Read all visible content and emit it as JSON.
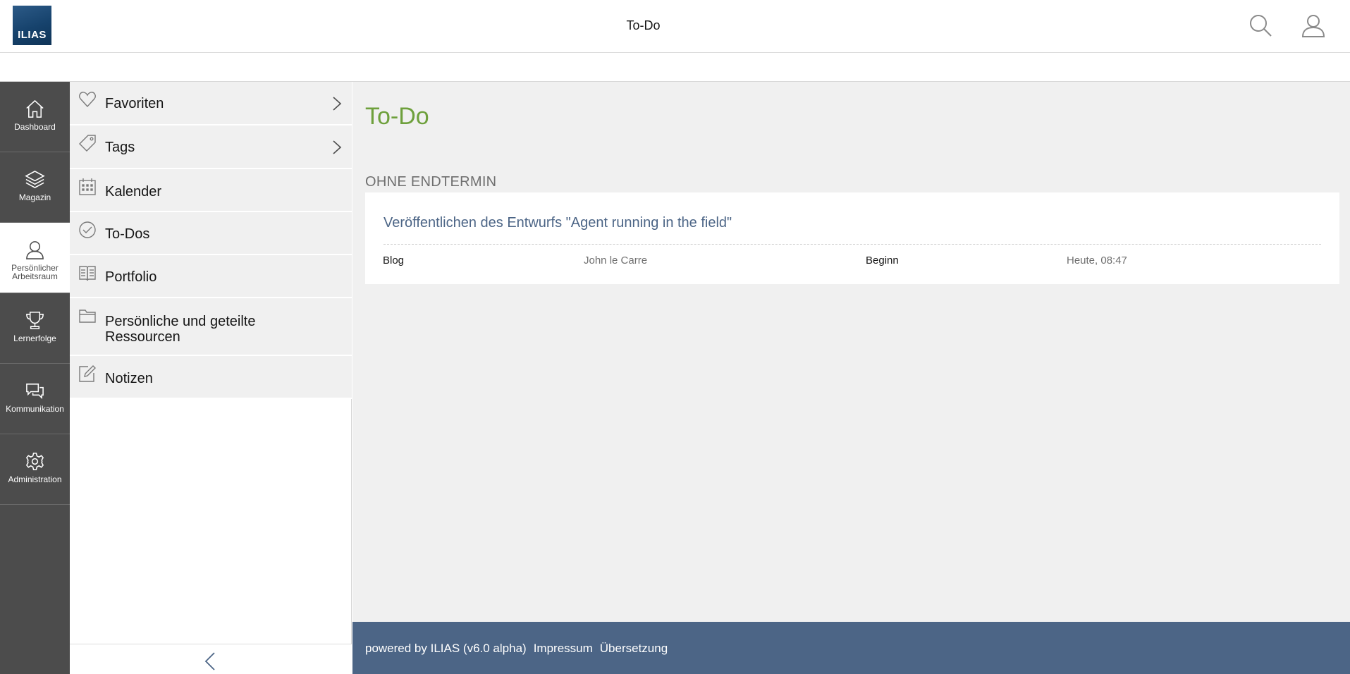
{
  "header": {
    "logo_text": "ILIAS",
    "title": "To-Do"
  },
  "mainbar": {
    "items": [
      {
        "label": "Dashboard"
      },
      {
        "label": "Magazin"
      },
      {
        "label": "Persönlicher Arbeitsraum"
      },
      {
        "label": "Lernerfolge"
      },
      {
        "label": "Kommunikation"
      },
      {
        "label": "Administration"
      }
    ]
  },
  "slate": {
    "items": [
      {
        "label": "Favoriten",
        "icon": "heart-icon"
      },
      {
        "label": "Tags",
        "icon": "tag-icon"
      },
      {
        "label": "Kalender",
        "icon": "calendar-icon"
      },
      {
        "label": "To-Dos",
        "icon": "check-circle-icon"
      },
      {
        "label": "Portfolio",
        "icon": "book-icon"
      },
      {
        "label": "Persönliche und geteilte Ressourcen",
        "icon": "folder-icon"
      },
      {
        "label": "Notizen",
        "icon": "edit-icon"
      }
    ]
  },
  "content": {
    "page_title": "To-Do",
    "section_title": "OHNE ENDTERMIN",
    "item": {
      "title": "Veröffentlichen des Entwurfs \"Agent running in the field\"",
      "type": "Blog",
      "author": "John le Carre",
      "start_label": "Beginn",
      "start_value": "Heute, 08:47"
    }
  },
  "footer": {
    "powered": "powered by ILIAS (v6.0 alpha)",
    "impressum": "Impressum",
    "translation": "Übersetzung"
  },
  "colors": {
    "mainbar_bg": "#4c4c4c",
    "accent_green": "#6ea03c",
    "link_blue": "#4c6586",
    "footer_bg": "#4c6586",
    "content_bg": "#f0f0f0"
  }
}
